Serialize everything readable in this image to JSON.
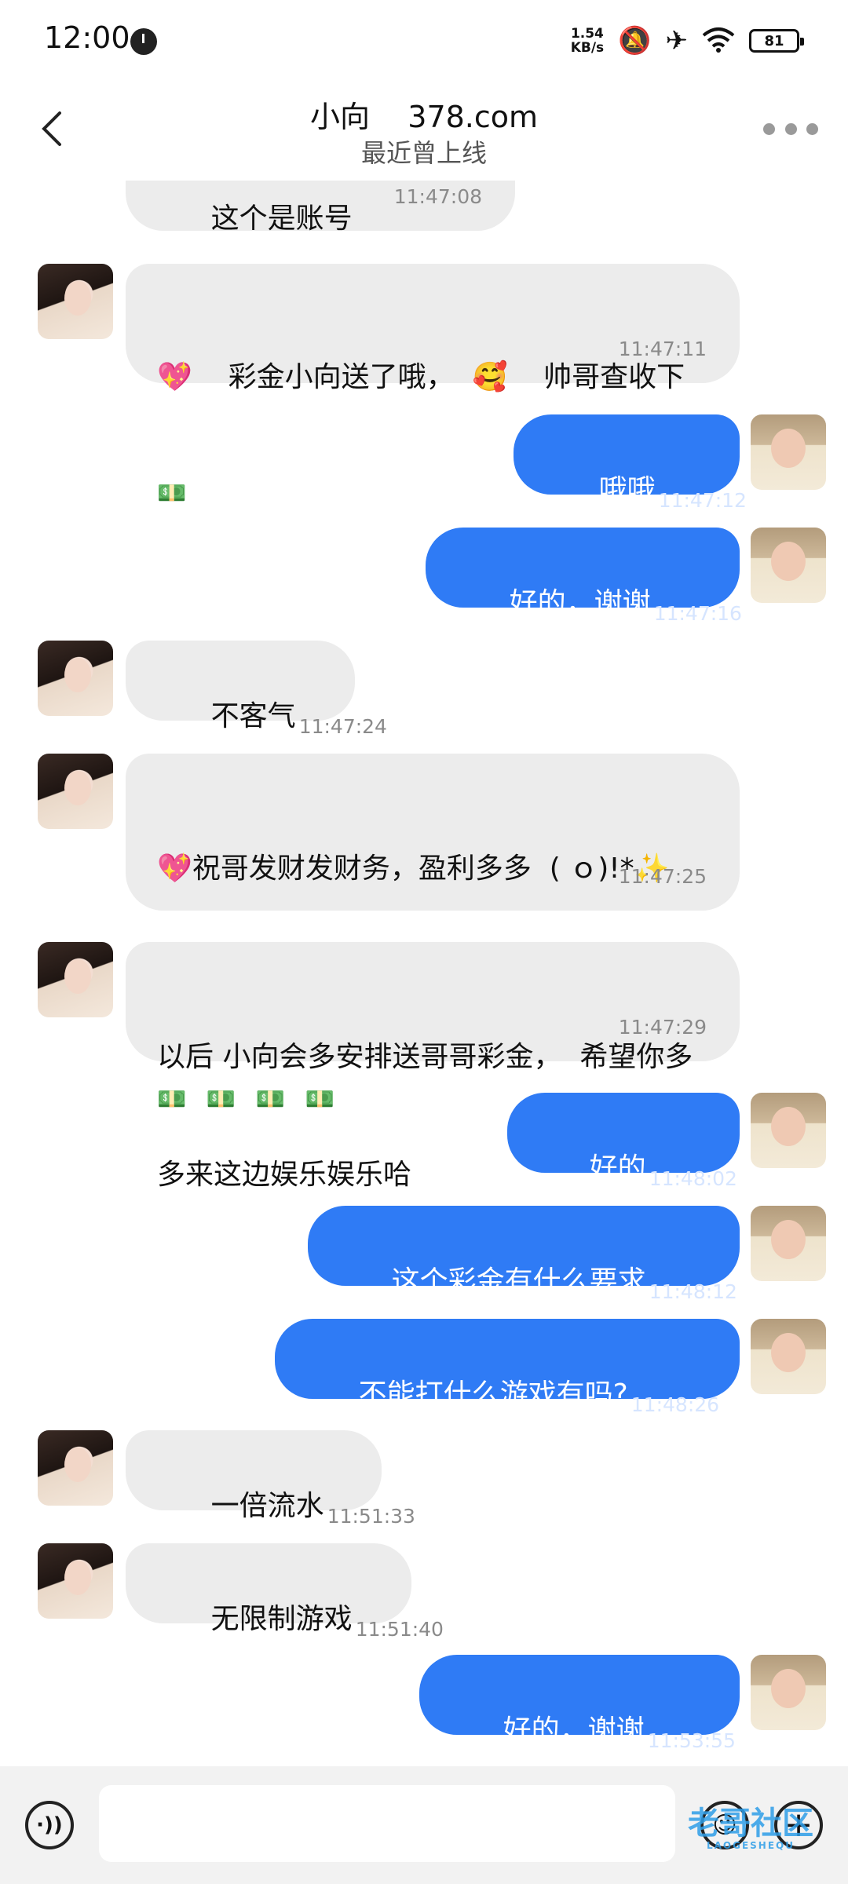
{
  "status_bar": {
    "time": "12:00",
    "net_speed_value": "1.54",
    "net_speed_unit": "KB/s",
    "battery": "81",
    "icons": [
      "alarm-clock-icon",
      "mute-bell-icon",
      "airplane-icon",
      "wifi-icon",
      "battery-icon"
    ]
  },
  "header": {
    "title": "小向    378.com",
    "subtitle": "最近曾上线"
  },
  "messages": [
    {
      "side": "in",
      "text": "这个是账号",
      "time": "11:47:08"
    },
    {
      "side": "in",
      "line1": "💖    彩金小向送了哦，  🥰    帅哥查收下",
      "line2": "💵",
      "time": "11:47:11"
    },
    {
      "side": "out",
      "text": "哦哦",
      "time": "11:47:12",
      "read": "✓✓"
    },
    {
      "side": "out",
      "text": "好的，谢谢",
      "time": "11:47:16",
      "read": "✓✓"
    },
    {
      "side": "in",
      "text": "不客气",
      "time": "11:47:24"
    },
    {
      "side": "in",
      "line1": "💖祝哥发财发财务，盈利多多  ( ｏ)!*✨",
      "line2": "💵 💵 💵 💵 💵 💵 💵 💵 💵 💵",
      "line3": "💵 💵 💵 💵",
      "time": "11:47:25"
    },
    {
      "side": "in",
      "line1": "以后 小向会多安排送哥哥彩金，  希望你多",
      "line2": "多来这边娱乐娱乐哈",
      "time": "11:47:29"
    },
    {
      "side": "out",
      "text": "好的",
      "time": "11:48:02",
      "read": "✓✓"
    },
    {
      "side": "out",
      "text": "这个彩金有什么要求",
      "time": "11:48:12",
      "read": "✓✓"
    },
    {
      "side": "out",
      "text": "不能打什么游戏有吗?",
      "time": "11:48:26",
      "read": "✓✓"
    },
    {
      "side": "in",
      "text": "一倍流水",
      "time": "11:51:33"
    },
    {
      "side": "in",
      "text": "无限制游戏",
      "time": "11:51:40"
    },
    {
      "side": "out",
      "text": "好的，谢谢",
      "time": "11:53:55",
      "read": "✓"
    }
  ],
  "bottom_bar": {
    "input_value": "",
    "watermark": "老哥社区",
    "watermark_sub": "LAOGESHEQU"
  }
}
